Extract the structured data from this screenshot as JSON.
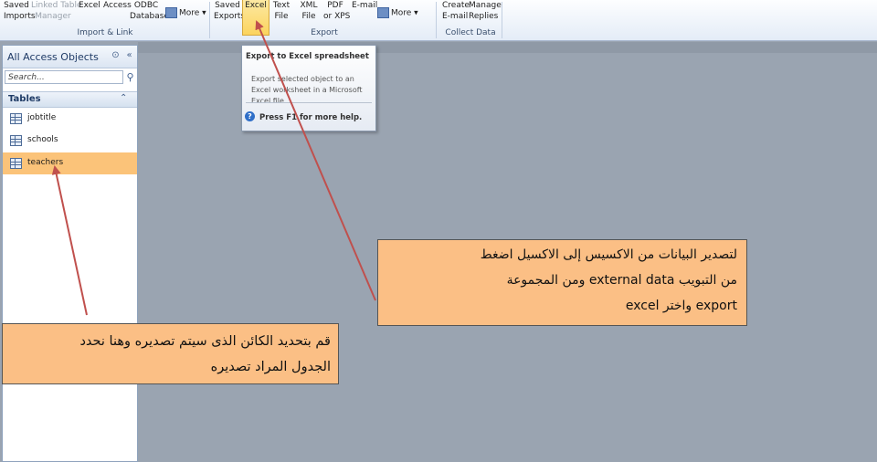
{
  "ribbon": {
    "import_group": {
      "buttons": [
        {
          "id": "saved-imports",
          "label": "Saved\nImports",
          "enabled": true
        },
        {
          "id": "linked-table-manager",
          "label": "Linked Table\nManager",
          "enabled": false
        },
        {
          "id": "excel-import",
          "label": "Excel",
          "enabled": true
        },
        {
          "id": "access-import",
          "label": "Access",
          "enabled": true
        },
        {
          "id": "odbc-database",
          "label": "ODBC\nDatabase",
          "enabled": true
        }
      ],
      "more_label": "More",
      "label": "Import & Link"
    },
    "export_group": {
      "buttons": [
        {
          "id": "saved-exports",
          "label": "Saved\nExports",
          "enabled": true
        },
        {
          "id": "excel-export",
          "label": "Excel",
          "enabled": true,
          "active": true
        },
        {
          "id": "text-file",
          "label": "Text\nFile",
          "enabled": true
        },
        {
          "id": "xml-file",
          "label": "XML\nFile",
          "enabled": true
        },
        {
          "id": "pdf-or-xps",
          "label": "PDF\nor XPS",
          "enabled": true
        },
        {
          "id": "email",
          "label": "E-mail",
          "enabled": true
        }
      ],
      "more_label": "More",
      "label": "Export"
    },
    "collect_group": {
      "buttons": [
        {
          "id": "create-email",
          "label": "Create\nE-mail",
          "enabled": true
        },
        {
          "id": "manage-replies",
          "label": "Manage\nReplies",
          "enabled": true
        }
      ],
      "label": "Collect Data"
    }
  },
  "nav": {
    "title": "All Access Objects",
    "search_placeholder": "Search...",
    "section": "Tables",
    "items": [
      {
        "label": "jobtitle",
        "selected": false
      },
      {
        "label": "schools",
        "selected": false
      },
      {
        "label": "teachers",
        "selected": true
      }
    ]
  },
  "tooltip": {
    "title": "Export to Excel spreadsheet",
    "body": "Export selected object to an Excel worksheet in a Microsoft Excel file.",
    "help": "Press F1 for more help."
  },
  "callouts": {
    "export": {
      "lines": [
        "لتصدير البيانات من الاكسيس إلى الاكسيل اضغط",
        "من التبويب external data ومن المجموعة",
        "export واختر excel"
      ]
    },
    "select": {
      "lines": [
        "قم بتحديد الكائن الذى سيتم تصديره وهنا نحدد",
        "الجدول المراد تصديره"
      ]
    }
  },
  "colors": {
    "selected_item": "#fbc379",
    "callout_bg": "#fbbf85",
    "arrow": "#c0504d",
    "active_button": "#fbd45e"
  }
}
